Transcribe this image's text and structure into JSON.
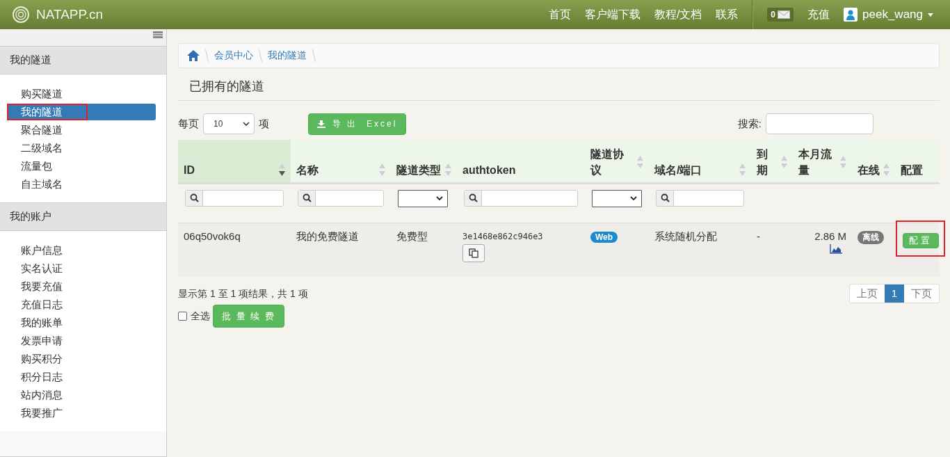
{
  "brand": "NATAPP.cn",
  "nav": [
    "首页",
    "客户端下载",
    "教程/文档",
    "联系"
  ],
  "message_count": "0",
  "recharge": "充值",
  "user": "peek_wang",
  "sidebar": [
    {
      "title": "我的隧道",
      "items": [
        {
          "label": "购买隧道",
          "selected": false,
          "highlighted": false
        },
        {
          "label": "我的隧道",
          "selected": true,
          "highlighted": true
        },
        {
          "label": "聚合隧道",
          "selected": false,
          "highlighted": false
        },
        {
          "label": "二级域名",
          "selected": false,
          "highlighted": false
        },
        {
          "label": "流量包",
          "selected": false,
          "highlighted": false
        },
        {
          "label": "自主域名",
          "selected": false,
          "highlighted": false
        }
      ]
    },
    {
      "title": "我的账户",
      "items": [
        {
          "label": "账户信息",
          "selected": false,
          "highlighted": false
        },
        {
          "label": "实名认证",
          "selected": false,
          "highlighted": false
        },
        {
          "label": "我要充值",
          "selected": false,
          "highlighted": false
        },
        {
          "label": "充值日志",
          "selected": false,
          "highlighted": false
        },
        {
          "label": "我的账单",
          "selected": false,
          "highlighted": false
        },
        {
          "label": "发票申请",
          "selected": false,
          "highlighted": false
        },
        {
          "label": "购买积分",
          "selected": false,
          "highlighted": false
        },
        {
          "label": "积分日志",
          "selected": false,
          "highlighted": false
        },
        {
          "label": "站内消息",
          "selected": false,
          "highlighted": false
        },
        {
          "label": "我要推广",
          "selected": false,
          "highlighted": false
        }
      ]
    }
  ],
  "breadcrumb": [
    "会员中心",
    "我的隧道"
  ],
  "page_title": "已拥有的隧道",
  "page_size": {
    "before": "每页",
    "value": "10",
    "after": "项"
  },
  "export_button": "导 出  Excel",
  "search_label": "搜索:",
  "table": {
    "columns": [
      {
        "label": "ID",
        "sortable": true,
        "sorted": true
      },
      {
        "label": "名称",
        "sortable": true,
        "sorted": false
      },
      {
        "label": "隧道类型",
        "sortable": true,
        "sorted": false
      },
      {
        "label": "authtoken",
        "sortable": false,
        "sorted": false
      },
      {
        "label": "隧道协议",
        "sortable": true,
        "sorted": false
      },
      {
        "label": "域名/端口",
        "sortable": true,
        "sorted": false
      },
      {
        "label": "到期",
        "sortable": true,
        "sorted": false
      },
      {
        "label": "本月流量",
        "sortable": true,
        "sorted": false
      },
      {
        "label": "在线",
        "sortable": true,
        "sorted": false
      },
      {
        "label": "配置",
        "sortable": false,
        "sorted": false
      }
    ],
    "filters": [
      {
        "kind": "search"
      },
      {
        "kind": "search"
      },
      {
        "kind": "select"
      },
      {
        "kind": "search"
      },
      {
        "kind": "select"
      },
      {
        "kind": "search"
      },
      {
        "kind": "none"
      },
      {
        "kind": "none"
      },
      {
        "kind": "none"
      },
      {
        "kind": "none"
      }
    ],
    "rows": [
      {
        "id": "06q50vok6q",
        "name": "我的免费隧道",
        "type": "免费型",
        "authtoken": "3e1468e862c946e3",
        "protocol": "Web",
        "domain": "系统随机分配",
        "expiry": "-",
        "traffic": "2.86 M",
        "status": "离线",
        "online": false,
        "config": "配置",
        "config_highlighted": true
      }
    ]
  },
  "summary": "显示第 1 至 1 项结果，共 1 项",
  "select_all": {
    "label": "全选",
    "checked": false
  },
  "renew_button": "批 量 续 费",
  "pagination": [
    {
      "label": "上页",
      "selected": false
    },
    {
      "label": "1",
      "selected": true
    },
    {
      "label": "下页",
      "selected": false
    }
  ]
}
